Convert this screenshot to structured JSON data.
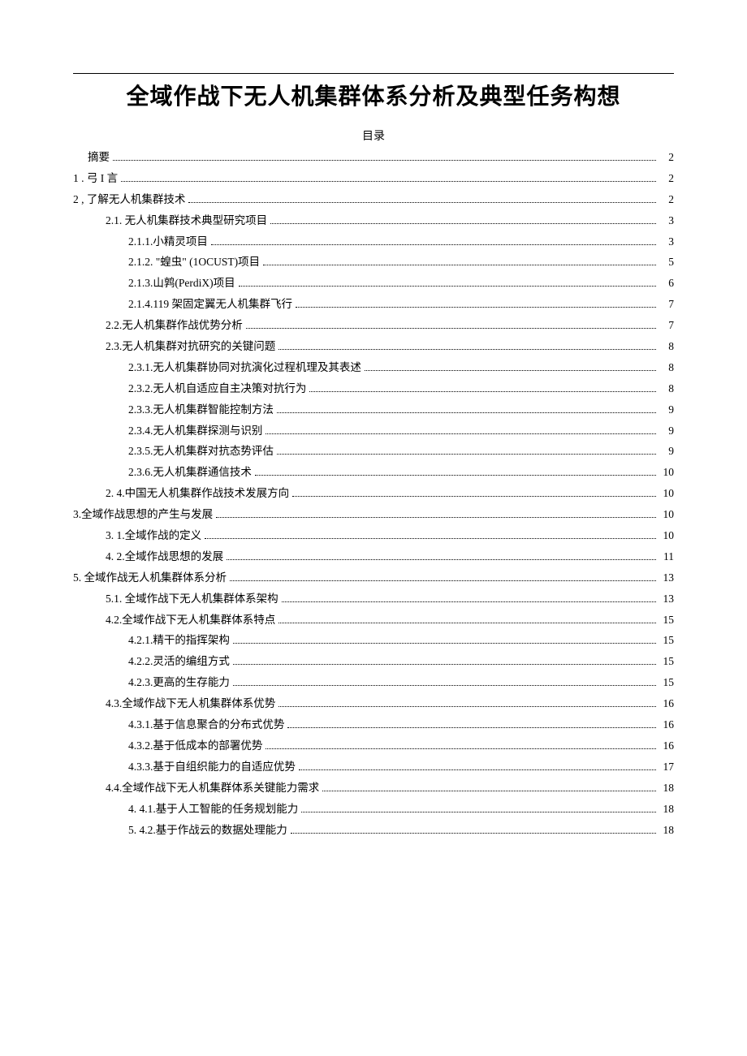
{
  "title": "全域作战下无人机集群体系分析及典型任务构想",
  "toc_label": "目录",
  "toc": [
    {
      "level": "lvl0",
      "text": "摘要",
      "page": "2"
    },
    {
      "level": "lvl1",
      "text": "1 . 弓 I 言",
      "page": "2"
    },
    {
      "level": "lvl1",
      "text": "2 , 了解无人机集群技术",
      "page": "2"
    },
    {
      "level": "lvl2",
      "text": "2.1.   无人机集群技术典型研究项目",
      "page": "3"
    },
    {
      "level": "lvl3",
      "text": "2.1.1.小精灵项目",
      "page": "3"
    },
    {
      "level": "lvl3",
      "text": "2.1.2. \"蝗虫\" (1OCUST)项目",
      "page": "5"
    },
    {
      "level": "lvl3",
      "text": "2.1.3.山鹑(PerdiX)项目",
      "page": "6"
    },
    {
      "level": "lvl3",
      "text": "2.1.4.119 架固定翼无人机集群飞行",
      "page": "7"
    },
    {
      "level": "lvl2",
      "text": "2.2.无人机集群作战优势分析",
      "page": "7"
    },
    {
      "level": "lvl2",
      "text": "2.3.无人机集群对抗研究的关键问题",
      "page": "8"
    },
    {
      "level": "lvl3",
      "text": "2.3.1.无人机集群协同对抗演化过程机理及其表述",
      "page": "8"
    },
    {
      "level": "lvl3",
      "text": "2.3.2.无人机自适应自主决策对抗行为",
      "page": "8"
    },
    {
      "level": "lvl3",
      "text": "2.3.3.无人机集群智能控制方法",
      "page": "9"
    },
    {
      "level": "lvl3",
      "text": "2.3.4.无人机集群探测与识别",
      "page": "9"
    },
    {
      "level": "lvl3",
      "text": "2.3.5.无人机集群对抗态势评估",
      "page": "9"
    },
    {
      "level": "lvl3",
      "text": "2.3.6.无人机集群通信技术",
      "page": "10"
    },
    {
      "level": "lvl2b",
      "text": "2.   4.中国无人机集群作战技术发展方向",
      "page": "10"
    },
    {
      "level": "lvl1",
      "text": "3.全域作战思想的产生与发展",
      "page": "10"
    },
    {
      "level": "lvl2b",
      "text": "3.   1.全域作战的定义",
      "page": "10"
    },
    {
      "level": "lvl2b",
      "text": "4.   2.全域作战思想的发展",
      "page": "11"
    },
    {
      "level": "lvl1",
      "text": "5.   全域作战无人机集群体系分析",
      "page": "13"
    },
    {
      "level": "lvl2",
      "text": "5.1.   全域作战下无人机集群体系架构",
      "page": "13"
    },
    {
      "level": "lvl2",
      "text": "4.2.全域作战下无人机集群体系特点",
      "page": "15"
    },
    {
      "level": "lvl3",
      "text": "4.2.1.精干的指挥架构",
      "page": "15"
    },
    {
      "level": "lvl3",
      "text": "4.2.2.灵活的编组方式",
      "page": "15"
    },
    {
      "level": "lvl3",
      "text": "4.2.3.更高的生存能力",
      "page": "15"
    },
    {
      "level": "lvl2",
      "text": "4.3.全域作战下无人机集群体系优势",
      "page": "16"
    },
    {
      "level": "lvl3",
      "text": "4.3.1.基于信息聚合的分布式优势",
      "page": "16"
    },
    {
      "level": "lvl3",
      "text": "4.3.2.基于低成本的部署优势",
      "page": "16"
    },
    {
      "level": "lvl3",
      "text": "4.3.3.基于自组织能力的自适应优势",
      "page": "17"
    },
    {
      "level": "lvl2",
      "text": "4.4.全域作战下无人机集群体系关键能力需求",
      "page": "18"
    },
    {
      "level": "lvl3",
      "text": "4.   4.1.基于人工智能的任务规划能力",
      "page": "18"
    },
    {
      "level": "lvl3",
      "text": "5.   4.2.基于作战云的数据处理能力",
      "page": "18"
    }
  ]
}
